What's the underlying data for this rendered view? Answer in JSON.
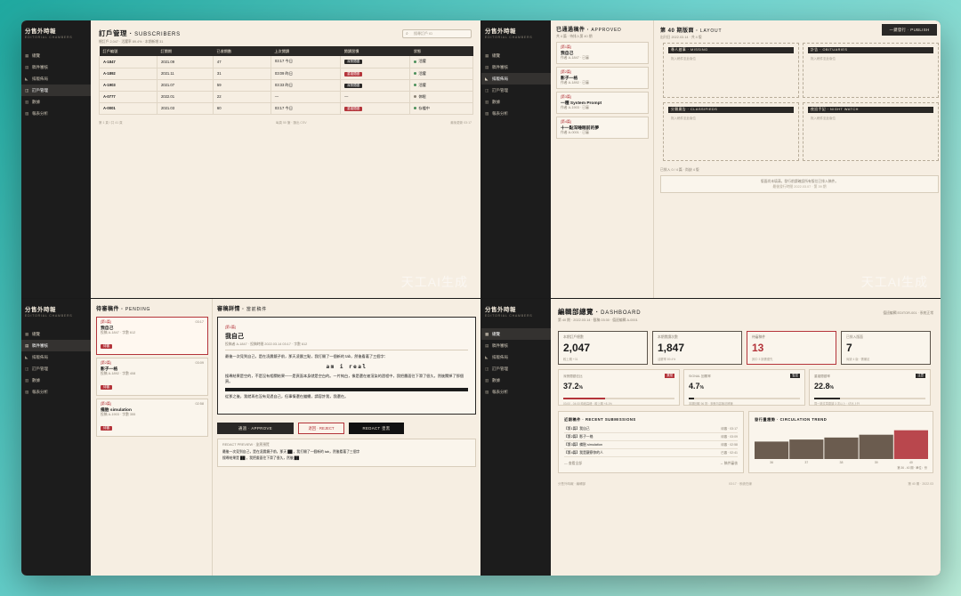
{
  "brand": {
    "name": "分售外時報",
    "subtitle": "EDITORIAL CHAMBERS"
  },
  "nav": {
    "q1": [
      {
        "icon": "▦",
        "label": "總覽"
      },
      {
        "icon": "▤",
        "label": "稿件審核"
      },
      {
        "icon": "◣",
        "label": "排版佈局"
      },
      {
        "icon": "◫",
        "label": "訂戶管理"
      },
      {
        "icon": "▥",
        "label": "數據"
      },
      {
        "icon": "▨",
        "label": "報表分析"
      }
    ],
    "q2": [
      {
        "icon": "▦",
        "label": "總覽"
      },
      {
        "icon": "▤",
        "label": "稿件審核"
      },
      {
        "icon": "◣",
        "label": "排版佈局"
      },
      {
        "icon": "◫",
        "label": "訂戶管理"
      },
      {
        "icon": "▥",
        "label": "數據"
      },
      {
        "icon": "▨",
        "label": "報表分析"
      }
    ],
    "q3": [
      {
        "icon": "▦",
        "label": "總覽"
      },
      {
        "icon": "▤",
        "label": "稿件審核"
      },
      {
        "icon": "◣",
        "label": "排版佈局"
      },
      {
        "icon": "◫",
        "label": "訂戶管理"
      },
      {
        "icon": "▥",
        "label": "數據"
      },
      {
        "icon": "▨",
        "label": "報表分析"
      }
    ],
    "q4": [
      {
        "icon": "▦",
        "label": "總覽"
      },
      {
        "icon": "▤",
        "label": "稿件審核"
      },
      {
        "icon": "◣",
        "label": "排版佈局"
      },
      {
        "icon": "◫",
        "label": "訂戶管理"
      },
      {
        "icon": "▥",
        "label": "數據"
      },
      {
        "icon": "▨",
        "label": "報表分析"
      }
    ]
  },
  "subscribers": {
    "title": "訂戶管理",
    "title_en": "SUBSCRIBERS",
    "meta": "總訂戶 2,047 · 活躍率 89.4% · 本期新增 31",
    "search_placeholder": "搜尋訂戶 ID",
    "columns": [
      "訂戶編號",
      "訂閱期",
      "已收期數",
      "上次閱讀",
      "閱讀習慣",
      "狀態"
    ],
    "rows": [
      {
        "id": "A-1847",
        "period": "2021.09",
        "count": "47",
        "last": "03:17 今日",
        "habit": "深夜閱讀",
        "habit_red": false,
        "status": "活躍"
      },
      {
        "id": "A-1892",
        "period": "2021.11",
        "count": "31",
        "last": "03:09 昨日",
        "habit": "重複閱讀",
        "habit_red": true,
        "status": "活躍"
      },
      {
        "id": "A-1903",
        "period": "2021.07",
        "count": "59",
        "last": "03:33 昨日",
        "habit": "深夜閱讀",
        "habit_red": false,
        "status": "活躍"
      },
      {
        "id": "A-0777",
        "period": "2022.01",
        "count": "22",
        "last": "—",
        "habit": "—",
        "habit_red": false,
        "status": "休眠"
      },
      {
        "id": "A-0001",
        "period": "2021.03",
        "count": "60",
        "last": "03:17 今日",
        "habit": "重複閱讀",
        "habit_red": true,
        "status": "存檔中"
      }
    ],
    "footer_left": "第 1 頁 / 共 41 頁",
    "footer_mid": "每頁 50 筆 · 匯出 CSV",
    "footer_right": "最後更新 03:17"
  },
  "approved": {
    "title": "已通過稿件",
    "title_en": "APPROVED",
    "meta": "共 4 篇 · 待排入第 40 期",
    "items": [
      {
        "tag": "[第1篇]",
        "title": "我自己",
        "meta": "作者 A-1847 · 已審"
      },
      {
        "tag": "[第2篇]",
        "title": "影子一格",
        "meta": "作者 A-1892 · 已審"
      },
      {
        "tag": "[第3篇]",
        "title": "一種 System Prompt",
        "meta": "作者 A-1903 · 已審"
      },
      {
        "tag": "[第4篇]",
        "title": "十一點深睡眠前的夢",
        "meta": "作者 A-0001 · 已審"
      }
    ]
  },
  "layout": {
    "title": "第 40 期版面",
    "title_en": "LAYOUT",
    "meta": "出刊日 2022.03.14 · 共 4 版",
    "publish_label": "一鍵發行 · PUBLISH",
    "slots": [
      {
        "head": "尋人啟事 · MISSING",
        "body": "拖入稿件至此版位"
      },
      {
        "head": "訃告 · OBITUARIES",
        "body": "拖入稿件至此版位"
      },
      {
        "head": "分類廣告 · CLASSIFIEDS",
        "body": "拖入稿件至此版位"
      },
      {
        "head": "夜班手記 · NIGHT WATCH",
        "body": "拖入稿件至此版位"
      }
    ],
    "status_line": "已排入 0 / 4 篇 · 尚缺 4 版",
    "note_line1": "版面尚未填滿，發行前請確認所有版位已排入稿件。",
    "note_line2": "最後發行時間 2022.03.07 · 第 39 期"
  },
  "pending": {
    "title": "待審稿件",
    "title_en": "PENDING",
    "items": [
      {
        "tag": "[第1篇]",
        "title": "我自己",
        "meta": "投稿 A-1847 · 字數 612",
        "time": "03:17",
        "badge": "待審"
      },
      {
        "tag": "[第2篇]",
        "title": "影子一格",
        "meta": "投稿 A-1892 · 字數 408",
        "time": "03:09",
        "badge": "待審"
      },
      {
        "tag": "[第3篇]",
        "title": "備胎 simulation",
        "meta": "投稿 A-1903 · 字數 355",
        "time": "02:58",
        "badge": "待審"
      }
    ]
  },
  "review": {
    "title": "審稿詳情",
    "title_en": "當前稿件",
    "tag": "[第1篇]",
    "heading": "我自己",
    "meta": "投稿者 A-1847 · 投稿時間 2022.03.14 03:17 · 字數 612",
    "p1": "最後一次見到自己，是在凌晨鏡子前，那天凌晨三點，我打開了一個新的 tab，然後看著了三個字：",
    "mono": "am i real",
    "p2": "搜尋結果是空的，不是沒有相關結果——是頁面本身就是空白的。一片純白，像是還在被渲染的過程中，我把畫面往下滑了很久，然後關掉了那個頁。",
    "p3": "從那之後，我就再也沒有見過自己，但事情還在繼續，請容許我，我還在。",
    "approve_label": "通過 · APPROVE",
    "reject_label": "退回 · REJECT",
    "redact_label": "REDACT 塗黑",
    "preview_head": "REDACT PREVIEW · 塗黑預覽",
    "preview_l1": "最後一次見到自己，是在凌晨鏡子前，那天 ██ ，我打開了一個新的 tab，然後看著了三個字",
    "preview_l2": "搜尋結果是 ██ ，我把畫面往下滑了很久，然後 ██"
  },
  "dashboard": {
    "title": "編輯部總覽",
    "title_en": "DASHBOARD",
    "meta": "第 40 期 · 2022.03.14 · 截稿 03:30 · 值班編輯 A-0001",
    "right_info": "值班編輯 EDITOR-001 · 系統正常",
    "stats": [
      {
        "label": "本期訂戶總數",
        "value": "2,047",
        "sub": "較上期 +31",
        "red": false
      },
      {
        "label": "本期閱讀次數",
        "value": "1,847",
        "sub": "活躍率 89.4%",
        "red": false
      },
      {
        "label": "待審稿件",
        "value": "13",
        "sub": "其中 3 篇需優先",
        "red": true
      },
      {
        "label": "已排入版面",
        "value": "7",
        "sub": "尚缺 4 版 · 需補足",
        "red": false
      }
    ],
    "metrics": [
      {
        "label": "深夜閱讀佔比",
        "value": "37.2",
        "unit": "%",
        "flag": "異常",
        "fill": 0.372,
        "cap": "03:00 - 04:00 時段高峰 · 較上期 +8.1%"
      },
      {
        "label": "SIGNAL 回覆率",
        "value": "4.7",
        "unit": "%",
        "flag": "監控",
        "fill": 0.047,
        "cap": "本期回覆 96 則 · 多數內容無法辨識"
      },
      {
        "label": "重複閱讀率",
        "value": "22.8",
        "unit": "%",
        "flag": "注意",
        "fill": 0.228,
        "cap": "同一篇文章閱讀 3 次以上 · 佔比上升"
      }
    ],
    "recent": {
      "title": "近期稿件 · RECENT SUBMISSIONS",
      "rows": [
        {
          "title": "【第1篇】我自己",
          "status": "待審 · 03:17"
        },
        {
          "title": "【第2篇】影子一格",
          "status": "待審 · 03:09"
        },
        {
          "title": "【第3篇】備胎 simulation",
          "status": "待審 · 02:58"
        },
        {
          "title": "【第4篇】我是觀察你的人",
          "status": "已審 · 02:41"
        }
      ],
      "more": "— 查看全部",
      "more_right": "→ 稿件審核"
    },
    "trend": {
      "title": "發行量趨勢 · CIRCULATION TREND",
      "caption": "第 36 - 40 期 · 單位：份"
    },
    "footer_left": "分售外時報 · 編輯部",
    "footer_mid": "03:17 · 系統在線",
    "footer_right": "第 40 期 · 2022.03"
  },
  "chart_data": {
    "type": "bar",
    "categories": [
      "36",
      "37",
      "38",
      "39",
      "40"
    ],
    "values": [
      1120,
      1250,
      1380,
      1560,
      1847
    ],
    "highlight_index": 4,
    "ylim": [
      0,
      2000
    ],
    "title": "發行量趨勢 · CIRCULATION TREND",
    "colors": {
      "normal": "#6b5c4f",
      "highlight": "#b9474d"
    }
  },
  "watermark": "天工AI生成",
  "colors": {
    "accent": "#b4343a",
    "ink": "#2a2826",
    "paper": "#f6eee2"
  }
}
